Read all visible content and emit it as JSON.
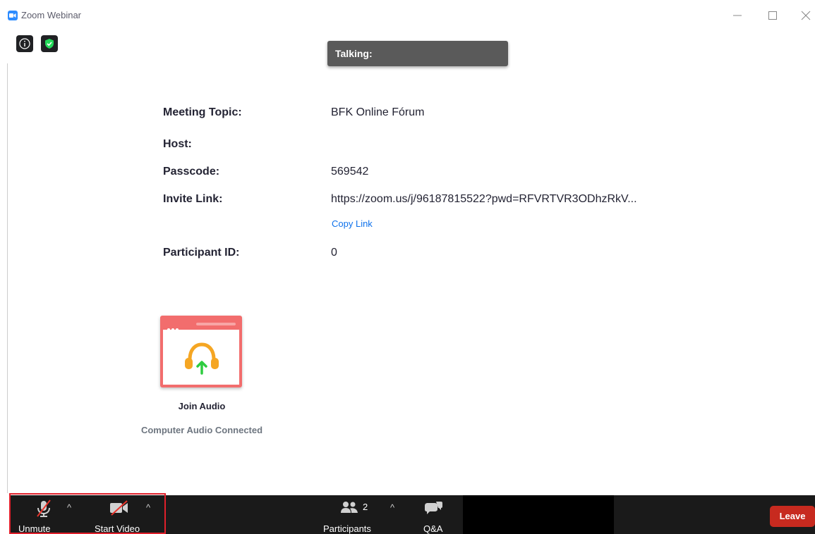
{
  "window": {
    "title": "Zoom Webinar"
  },
  "talking": {
    "label": "Talking:"
  },
  "meeting_info": {
    "topic_label": "Meeting Topic:",
    "topic_value": "BFK Online Fórum",
    "host_label": "Host:",
    "host_value": "",
    "passcode_label": "Passcode:",
    "passcode_value": "569542",
    "invite_label": "Invite Link:",
    "invite_value": "https://zoom.us/j/96187815522?pwd=RFVRTVR3ODhzRkV...",
    "copy_link_label": "Copy Link",
    "participant_id_label": "Participant ID:",
    "participant_id_value": "0"
  },
  "audio": {
    "join_label": "Join Audio",
    "status": "Computer Audio Connected"
  },
  "toolbar": {
    "unmute_label": "Unmute",
    "start_video_label": "Start Video",
    "participants_label": "Participants",
    "participants_count": "2",
    "qa_label": "Q&A",
    "leave_label": "Leave"
  },
  "colors": {
    "accent": "#2D8CFF",
    "audio_card": "#F26D6D",
    "leave": "#C72A1F",
    "highlight": "#e0202b",
    "link": "#0E71EB"
  }
}
